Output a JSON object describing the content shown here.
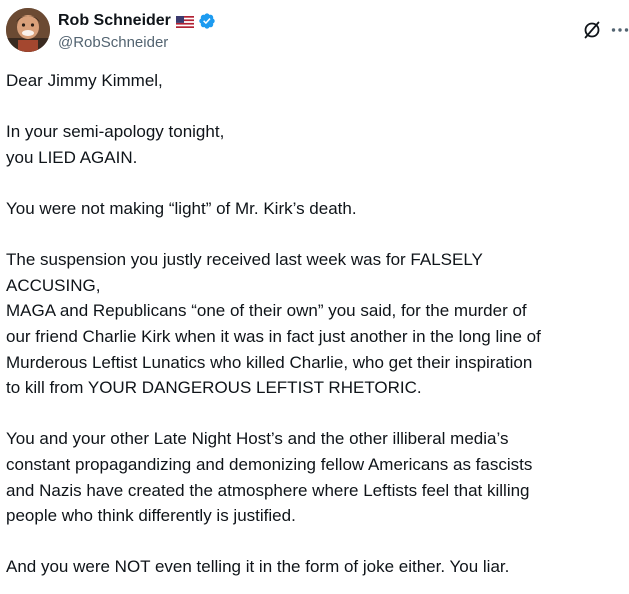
{
  "author": {
    "display_name": "Rob Schneider",
    "flag_icon": "us-flag-icon",
    "verified_icon": "verified-badge-icon",
    "handle": "@RobSchneider"
  },
  "actions": {
    "grok_icon": "grok-icon",
    "more_icon": "more-options-icon"
  },
  "colors": {
    "text": "#0f1419",
    "secondary": "#536471",
    "verified": "#1d9bf0"
  },
  "tweet": {
    "lines": [
      "Dear Jimmy Kimmel,",
      "",
      "In your semi-apology tonight,",
      "you LIED AGAIN.",
      "",
      "You were not making “light” of Mr. Kirk’s death.",
      "",
      "The suspension you justly received last week was for FALSELY",
      "ACCUSING,",
      "MAGA and Republicans “one of their own” you said, for the murder of",
      "our friend Charlie Kirk when it was in fact just another in the long line of",
      "Murderous Leftist Lunatics who killed Charlie, who get their inspiration",
      "to kill from YOUR DANGEROUS LEFTIST RHETORIC.",
      "",
      "You and your other Late Night Host’s and the other illiberal media’s",
      "constant propagandizing and demonizing fellow Americans as fascists",
      "and Nazis have created the atmosphere where Leftists feel that killing",
      "people who think differently is justified.",
      "",
      "And you were NOT even telling it in the form of joke either. You liar."
    ]
  }
}
